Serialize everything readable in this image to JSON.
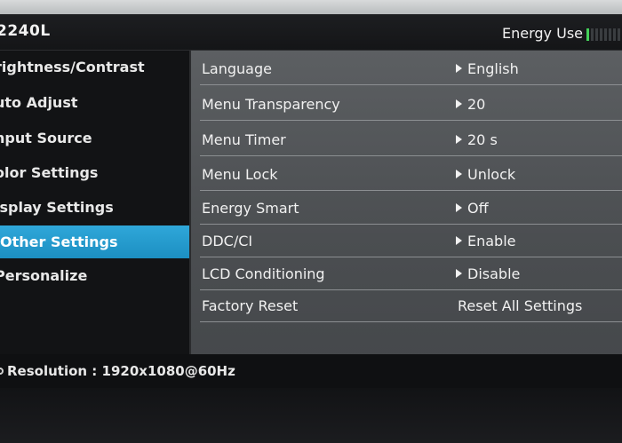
{
  "title_bar": {
    "model": "2240L",
    "energy_label": "Energy Use",
    "energy_level": 0.1
  },
  "left_menu": {
    "items": [
      {
        "label": "rightness/Contrast",
        "selected": false
      },
      {
        "label": "uto Adjust",
        "selected": false
      },
      {
        "label": "nput Source",
        "selected": false
      },
      {
        "label": "olor Settings",
        "selected": false
      },
      {
        "label": "isplay Settings",
        "selected": false
      },
      {
        "label": "Other Settings",
        "selected": true
      },
      {
        "label": "Personalize",
        "selected": false
      }
    ]
  },
  "settings": {
    "rows": [
      {
        "name": "Language",
        "value": "English",
        "arrow": true
      },
      {
        "name": "Menu Transparency",
        "value": "20",
        "arrow": true
      },
      {
        "name": "Menu Timer",
        "value": "20 s",
        "arrow": true
      },
      {
        "name": "Menu Lock",
        "value": "Unlock",
        "arrow": true
      },
      {
        "name": "Energy Smart",
        "value": "Off",
        "arrow": true
      },
      {
        "name": "DDC/CI",
        "value": "Enable",
        "arrow": true
      },
      {
        "name": "LCD Conditioning",
        "value": "Disable",
        "arrow": true
      },
      {
        "name": "Factory Reset",
        "value": "Reset All Settings",
        "arrow": false
      }
    ]
  },
  "status": {
    "resolution_text": "Resolution : 1920x1080@60Hz"
  },
  "colors": {
    "selected_highlight": "#2fa7d9",
    "energy_on": "#44d15a",
    "panel_gray": "#54575a"
  }
}
